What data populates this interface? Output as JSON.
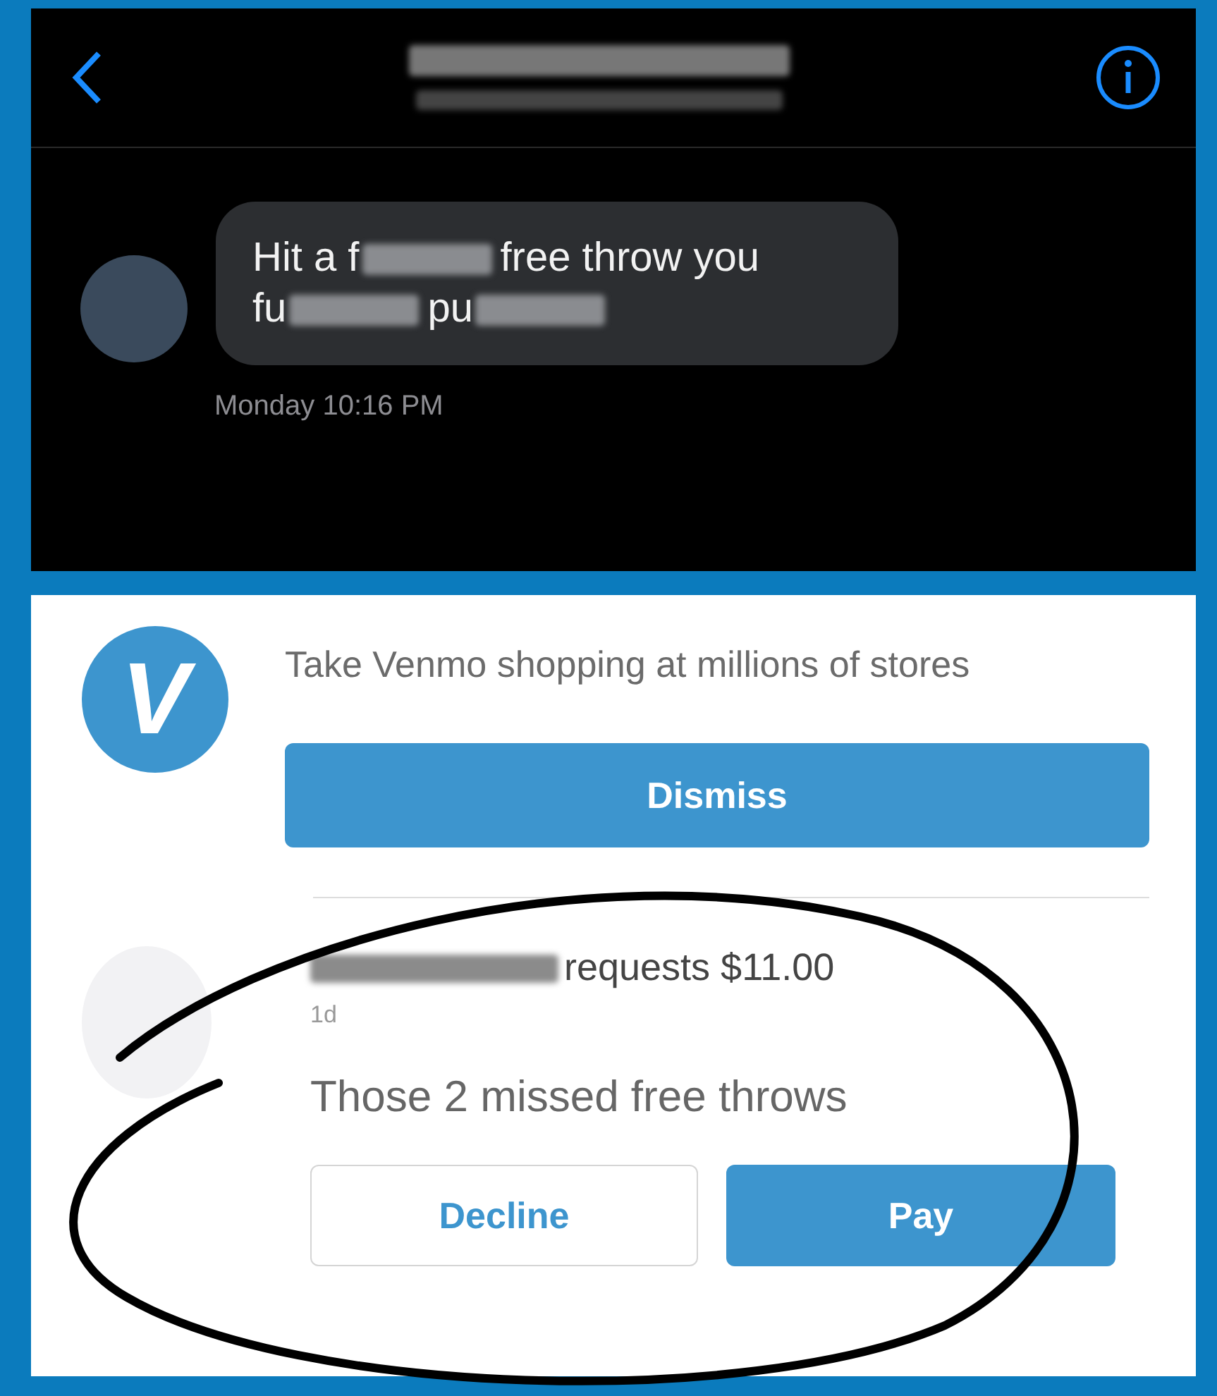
{
  "chat": {
    "message": [
      {
        "kind": "text",
        "text": "Hit a f"
      },
      {
        "kind": "blur"
      },
      {
        "kind": "text",
        "text": "free throw you"
      },
      {
        "kind": "break"
      },
      {
        "kind": "text",
        "text": "fu"
      },
      {
        "kind": "blur"
      },
      {
        "kind": "text",
        "text": "pu"
      },
      {
        "kind": "blur"
      }
    ],
    "timestamp": "Monday 10:16 PM"
  },
  "venmo": {
    "logo_letter": "V",
    "promo": "Take Venmo shopping at millions of stores",
    "dismiss": "Dismiss",
    "request": {
      "action": "requests $11.00",
      "age": "1d",
      "note": "Those 2 missed free throws",
      "decline": "Decline",
      "pay": "Pay"
    }
  }
}
